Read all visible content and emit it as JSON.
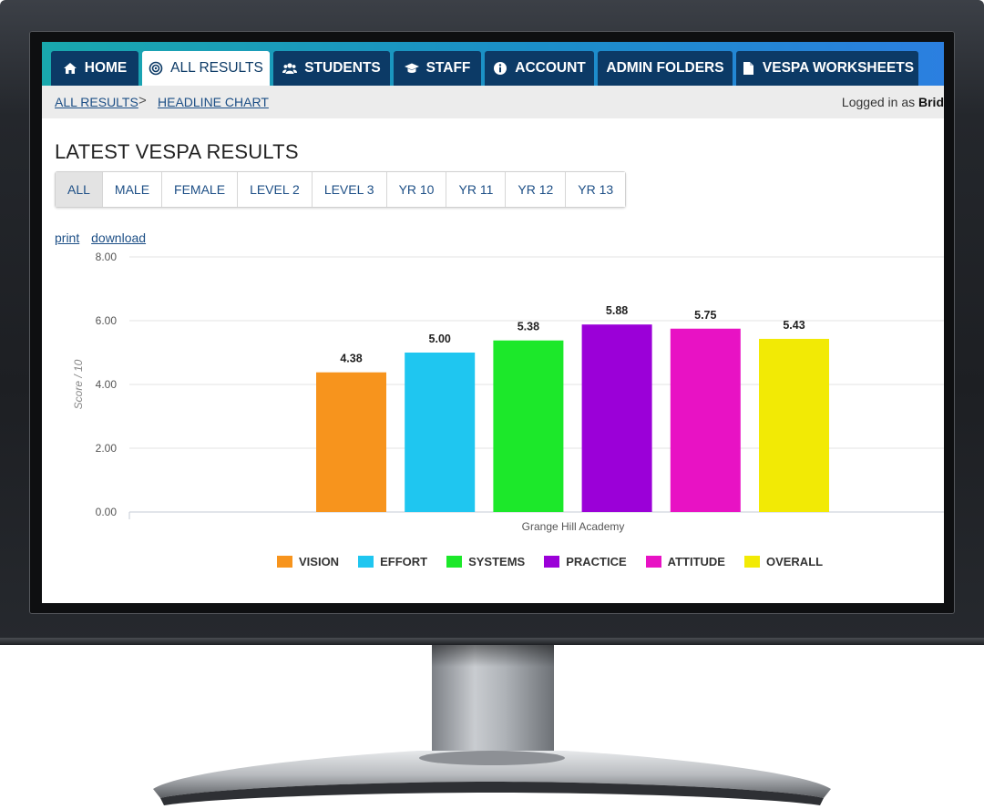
{
  "nav": {
    "tabs": [
      {
        "label": "HOME",
        "icon": "home-icon"
      },
      {
        "label": "ALL RESULTS",
        "icon": "target-icon",
        "active": true
      },
      {
        "label": "STUDENTS",
        "icon": "users-icon"
      },
      {
        "label": "STAFF",
        "icon": "graduation-cap-icon"
      },
      {
        "label": "ACCOUNT",
        "icon": "info-circle-icon"
      },
      {
        "label": "ADMIN FOLDERS",
        "icon": ""
      },
      {
        "label": "VESPA WORKSHEETS",
        "icon": "file-icon"
      }
    ]
  },
  "breadcrumb": {
    "items": [
      "ALL RESULTS",
      "HEADLINE CHART"
    ],
    "separator": ">"
  },
  "logged_in": {
    "prefix": "Logged in as",
    "name": "Brid"
  },
  "page_title": "LATEST VESPA RESULTS",
  "filters": [
    "ALL",
    "MALE",
    "FEMALE",
    "LEVEL 2",
    "LEVEL 3",
    "YR 10",
    "YR 11",
    "YR 12",
    "YR 13"
  ],
  "active_filter": "ALL",
  "links": {
    "print": "print",
    "download": "download"
  },
  "chart_data": {
    "type": "bar",
    "categories": [
      "Grange Hill Academy"
    ],
    "series": [
      {
        "name": "VISION",
        "values": [
          4.38
        ],
        "color": "#f7941d"
      },
      {
        "name": "EFFORT",
        "values": [
          5.0
        ],
        "color": "#1fc6f0"
      },
      {
        "name": "SYSTEMS",
        "values": [
          5.38
        ],
        "color": "#1ce82a"
      },
      {
        "name": "PRACTICE",
        "values": [
          5.88
        ],
        "color": "#9b00d8"
      },
      {
        "name": "ATTITUDE",
        "values": [
          5.75
        ],
        "color": "#e812c4"
      },
      {
        "name": "OVERALL",
        "values": [
          5.43
        ],
        "color": "#f2ea05"
      }
    ],
    "value_labels": [
      "4.38",
      "5.00",
      "5.38",
      "5.88",
      "5.75",
      "5.43"
    ],
    "xlabel": "Grange Hill Academy",
    "ylabel": "Score / 10",
    "ylim": [
      0,
      8
    ],
    "yticks": [
      "0.00",
      "2.00",
      "4.00",
      "6.00",
      "8.00"
    ],
    "grid": true,
    "legend": "bottom"
  },
  "colors": {
    "nav_dark": "#0c3a66",
    "link": "#1d4f86",
    "gradient_start": "#19a8ad",
    "gradient_end": "#2b7fe0"
  }
}
